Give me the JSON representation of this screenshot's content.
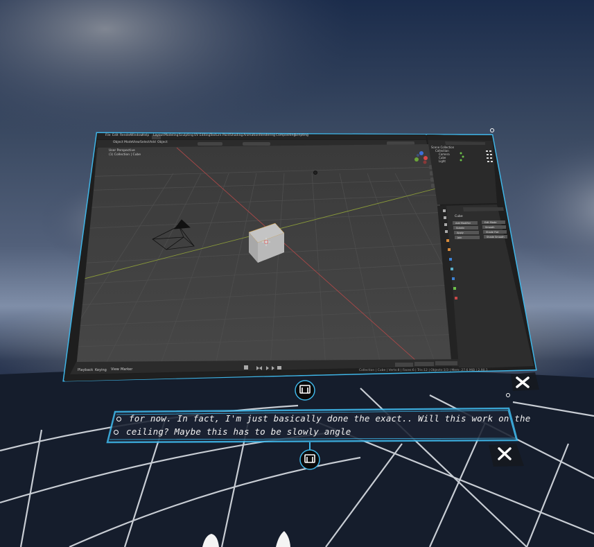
{
  "blender": {
    "menu": [
      "File",
      "Edit",
      "Render",
      "Window",
      "Help"
    ],
    "workspaces": [
      "Layout",
      "Modeling",
      "Sculpting",
      "UV Editing",
      "Texture Paint",
      "Shading",
      "Animation",
      "Rendering",
      "Compositing",
      "Scripting"
    ],
    "viewport_header": [
      "Object Mode",
      "View",
      "Select",
      "Add",
      "Object"
    ],
    "viewport_info": [
      "User Perspective",
      "(1) Collection | Cube"
    ],
    "outliner": {
      "title": "Scene Collection",
      "items": [
        "Collection",
        "Camera",
        "Cube",
        "Light"
      ]
    },
    "properties": {
      "object_name": "Cube",
      "buttons": [
        "Add Modifier",
        "Edit Mode",
        "Subdiv",
        "Smooth",
        "Apply",
        "Shade Flat",
        "Join",
        "Shade Smooth"
      ]
    },
    "timeline_menu": [
      "Playback",
      "Keying",
      "View",
      "Marker"
    ],
    "status_text": "Collection | Cube | Verts:8 | Faces:6 | Tris:12 | Objects:1/3 | Mem: 27.6 MiB | 2.90.1"
  },
  "captions": {
    "line1": "for now. In fact, I'm just basically done the exact.. Will this work on the",
    "line2": "ceiling? Maybe this has to be slowly angle"
  },
  "icons": {
    "window_drag_handle": "window-drag-icon",
    "captions_drag_handle": "window-drag-icon",
    "close_window": "close-icon",
    "close_captions": "close-icon"
  },
  "colors": {
    "frame_accent": "#3fb6e8",
    "viewport_bg": "#3d3d3d",
    "panel_bg": "#2a2a2a",
    "sky_dark": "#0d1a33"
  }
}
